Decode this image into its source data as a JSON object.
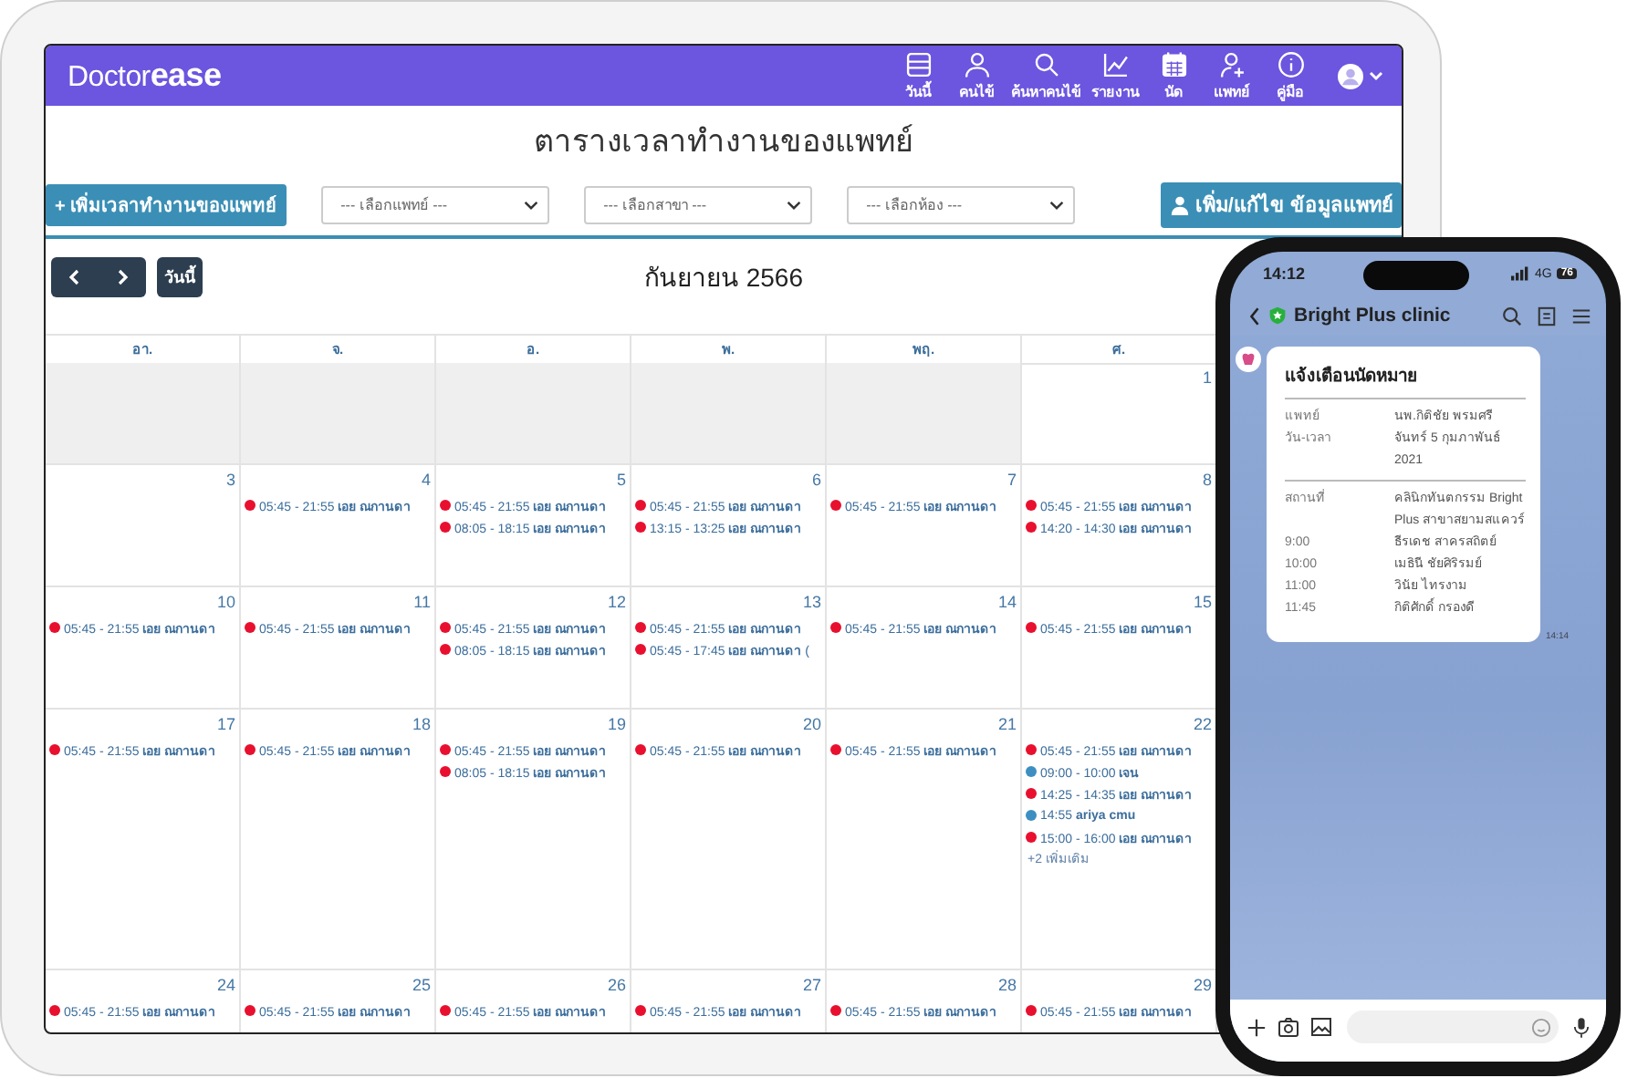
{
  "tablet": {
    "app_bar": {
      "logo": "Doctor**ease**",
      "nav": [
        {
          "kind": "table",
          "label": "วันนี้"
        },
        {
          "kind": "person",
          "label": "คนไข้"
        },
        {
          "kind": "search",
          "label": "ค้นหาคนไข้"
        },
        {
          "kind": "chart",
          "label": "รายงาน"
        },
        {
          "kind": "calendar",
          "label": "นัด"
        },
        {
          "kind": "person-add",
          "label": "แพทย์"
        },
        {
          "kind": "info",
          "label": "คู่มือ"
        }
      ]
    },
    "page_title": "ตารางเวลาทำงานของแพทย์",
    "add_button": "+ เพิ่มเวลาทำงานของแพทย์",
    "selects": [
      {
        "placeholder": "--- เลือกแพทย์ ---"
      },
      {
        "placeholder": "--- เลือกสาขา ---"
      },
      {
        "placeholder": "--- เลือกห้อง ---"
      }
    ],
    "edit_button": "เพิ่ม/แก้ไข ข้อมูลแพทย์",
    "today_button": "วันนี้",
    "month_title": "กันยายน 2566",
    "headers": [
      "อา.",
      "จ.",
      "อ.",
      "พ.",
      "พฤ.",
      "ศ."
    ],
    "weeks": [
      {
        "days": [
          {
            "outside": true
          },
          {
            "outside": true
          },
          {
            "outside": true
          },
          {
            "outside": true
          },
          {
            "outside": true
          },
          {
            "outside": false,
            "date": "1"
          }
        ]
      },
      {
        "days": [
          {
            "outside": false,
            "date": "3"
          },
          {
            "outside": false,
            "date": "4",
            "events": [
              {
                "text": "05:45 - 21:55 **เอย ณกานดา**",
                "color": "#e8102e"
              }
            ]
          },
          {
            "outside": false,
            "date": "5",
            "events": [
              {
                "text": "05:45 - 21:55 **เอย ณกานดา**",
                "color": "#e8102e"
              },
              {
                "text": "08:05 - 18:15 **เอย ณกานดา**",
                "color": "#e8102e"
              }
            ]
          },
          {
            "outside": false,
            "date": "6",
            "events": [
              {
                "text": "05:45 - 21:55 **เอย ณกานดา**",
                "color": "#e8102e"
              },
              {
                "text": "13:15 - 13:25 **เอย ณกานดา**",
                "color": "#e8102e"
              }
            ]
          },
          {
            "outside": false,
            "date": "7",
            "events": [
              {
                "text": "05:45 - 21:55 **เอย ณกานดา**",
                "color": "#e8102e"
              }
            ]
          },
          {
            "outside": false,
            "date": "8",
            "events": [
              {
                "text": "05:45 - 21:55 **เอย ณกานดา**",
                "color": "#e8102e"
              },
              {
                "text": "14:20 - 14:30 **เอย ณกานดา**",
                "color": "#e8102e"
              }
            ]
          }
        ]
      },
      {
        "days": [
          {
            "outside": false,
            "date": "10",
            "events": [
              {
                "text": "05:45 - 21:55 **เอย ณกานดา**",
                "color": "#e8102e"
              }
            ]
          },
          {
            "outside": false,
            "date": "11",
            "events": [
              {
                "text": "05:45 - 21:55 **เอย ณกานดา**",
                "color": "#e8102e"
              }
            ]
          },
          {
            "outside": false,
            "date": "12",
            "events": [
              {
                "text": "05:45 - 21:55 **เอย ณกานดา**",
                "color": "#e8102e"
              },
              {
                "text": "08:05 - 18:15 **เอย ณกานดา**",
                "color": "#e8102e"
              }
            ]
          },
          {
            "outside": false,
            "date": "13",
            "events": [
              {
                "text": "05:45 - 21:55 **เอย ณกานดา**",
                "color": "#e8102e"
              },
              {
                "text": "05:45 - 17:45 **เอย ณกานดา** (",
                "color": "#e8102e"
              }
            ]
          },
          {
            "outside": false,
            "date": "14",
            "events": [
              {
                "text": "05:45 - 21:55 **เอย ณกานดา**",
                "color": "#e8102e"
              }
            ]
          },
          {
            "outside": false,
            "date": "15",
            "events": [
              {
                "text": "05:45 - 21:55 **เอย ณกานดา**",
                "color": "#e8102e"
              }
            ]
          }
        ]
      },
      {
        "days": [
          {
            "outside": false,
            "date": "17",
            "events": [
              {
                "text": "05:45 - 21:55 **เอย ณกานดา**",
                "color": "#e8102e"
              }
            ]
          },
          {
            "outside": false,
            "date": "18",
            "events": [
              {
                "text": "05:45 - 21:55 **เอย ณกานดา**",
                "color": "#e8102e"
              }
            ]
          },
          {
            "outside": false,
            "date": "19",
            "events": [
              {
                "text": "05:45 - 21:55 **เอย ณกานดา**",
                "color": "#e8102e"
              },
              {
                "text": "08:05 - 18:15 **เอย ณกานดา**",
                "color": "#e8102e"
              }
            ]
          },
          {
            "outside": false,
            "date": "20",
            "events": [
              {
                "text": "05:45 - 21:55 **เอย ณกานดา**",
                "color": "#e8102e"
              }
            ]
          },
          {
            "outside": false,
            "date": "21",
            "events": [
              {
                "text": "05:45 - 21:55 **เอย ณกานดา**",
                "color": "#e8102e"
              }
            ]
          },
          {
            "outside": false,
            "date": "22",
            "events": [
              {
                "text": "05:45 - 21:55 **เอย ณกานดา**",
                "color": "#e8102e"
              },
              {
                "text": "09:00 - 10:00 **เจน**",
                "color": "#3d8fc2"
              },
              {
                "text": "14:25 - 14:35 **เอย ณกานดา**",
                "color": "#e8102e"
              },
              {
                "text": "14:55 **ariya cmu**",
                "color": "#3d8fc2"
              },
              {
                "text": "15:00 - 16:00 **เอย ณกานดา**",
                "color": "#e8102e"
              }
            ],
            "more": "+2 เพิ่มเติม"
          }
        ]
      },
      {
        "days": [
          {
            "outside": false,
            "date": "24",
            "events": [
              {
                "text": "05:45 - 21:55 **เอย ณกานดา**",
                "color": "#e8102e"
              }
            ]
          },
          {
            "outside": false,
            "date": "25",
            "events": [
              {
                "text": "05:45 - 21:55 **เอย ณกานดา**",
                "color": "#e8102e"
              }
            ]
          },
          {
            "outside": false,
            "date": "26",
            "events": [
              {
                "text": "05:45 - 21:55 **เอย ณกานดา**",
                "color": "#e8102e"
              }
            ]
          },
          {
            "outside": false,
            "date": "27",
            "events": [
              {
                "text": "05:45 - 21:55 **เอย ณกานดา**",
                "color": "#e8102e"
              }
            ]
          },
          {
            "outside": false,
            "date": "28",
            "events": [
              {
                "text": "05:45 - 21:55 **เอย ณกานดา**",
                "color": "#e8102e"
              }
            ]
          },
          {
            "outside": false,
            "date": "29",
            "events": [
              {
                "text": "05:45 - 21:55 **เอย ณกานดา**",
                "color": "#e8102e"
              }
            ]
          }
        ]
      }
    ]
  },
  "phone": {
    "status_time": "14:12",
    "network": "4G",
    "battery": "76",
    "chat_title": "Bright Plus clinic",
    "message": {
      "title": "แจ้งเตือนนัดหมาย",
      "sections": [
        {
          "rows": [
            {
              "label": "แพทย์",
              "value": "นพ.กิติชัย พรมศรี"
            },
            {
              "label": "วัน-เวลา",
              "value": "จันทร์ 5 กุมภาพันธ์ 2021"
            }
          ]
        },
        {
          "rows": [
            {
              "label": "สถานที่",
              "value": "คลินิกทันตกรรม Bright Plus สาขาสยามสแควร์"
            },
            {
              "label": "9:00",
              "value": "ธีรเดช สาครสถิตย์"
            },
            {
              "label": "10:00",
              "value": "เมธินี ชัยศิริรมย์"
            },
            {
              "label": "11:00",
              "value": "วินัย ไทรงาม"
            },
            {
              "label": "11:45",
              "value": "กิติศักดิ์ กรองดี"
            }
          ]
        }
      ],
      "time": "14:14"
    }
  }
}
